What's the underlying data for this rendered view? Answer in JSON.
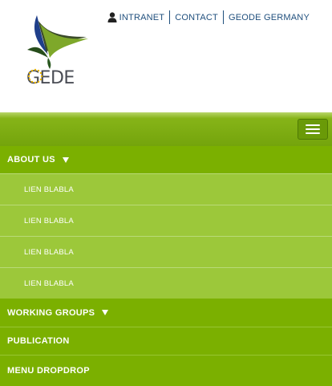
{
  "logo": {
    "text_left": "GE",
    "text_right": "DE",
    "icon": "geode-logo-icon"
  },
  "toplinks": {
    "user_icon": "user-icon",
    "items": [
      "INTRANET",
      "CONTACT",
      "GEODE GERMANY"
    ]
  },
  "navbar": {
    "menu_icon": "hamburger-menu-icon"
  },
  "menu": {
    "about": "ABOUT US",
    "sub_items": [
      "LIEN BLABLA",
      "LIEN BLABLA",
      "LIEN BLABLA",
      "LIEN BLABLA"
    ],
    "working_groups": "WORKING GROUPS",
    "publication": "PUBLICATION",
    "dropdrop": "MENU DROPDROP"
  },
  "colors": {
    "menu_green": "#7bb000",
    "submenu_green": "#9cc83a",
    "link_blue": "#1f4f7d"
  }
}
